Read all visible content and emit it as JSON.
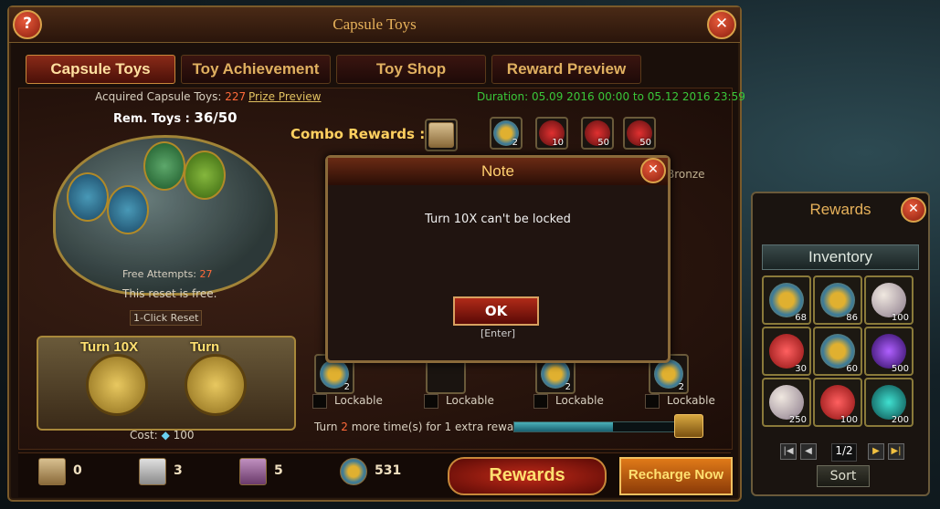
{
  "window": {
    "title": "Capsule Toys",
    "help_label": "?",
    "close_label": "✕"
  },
  "tabs": [
    {
      "label": "Capsule Toys",
      "active": true
    },
    {
      "label": "Toy Achievement",
      "active": false
    },
    {
      "label": "Toy Shop",
      "active": false
    },
    {
      "label": "Reward Preview",
      "active": false
    }
  ],
  "info": {
    "acquired_label": "Acquired Capsule Toys:",
    "acquired_value": "227",
    "prize_preview": "Prize Preview",
    "duration": "Duration: 05.09 2016 00:00 to 05.12 2016 23:59",
    "rem_toys_label": "Rem. Toys :",
    "rem_toys_value": "36/50",
    "combo_rewards_label": "Combo Rewards :",
    "combo_counts": [
      "2",
      "10",
      "50",
      "50"
    ],
    "bronze_label": "Bronze"
  },
  "machine": {
    "free_attempts_label": "Free Attempts:",
    "free_attempts_value": "27",
    "reset_note": "This reset is free.",
    "reset_button": "1-Click Reset",
    "turn10_label": "Turn 10X",
    "turn_label": "Turn",
    "cost_label": "Cost:",
    "cost_value": "100"
  },
  "lockable": {
    "slots": [
      {
        "count": "2",
        "label": "Lockable"
      },
      {
        "count": "",
        "label": "Lockable"
      },
      {
        "count": "2",
        "label": "Lockable"
      },
      {
        "count": "2",
        "label": "Lockable"
      }
    ],
    "turn_prefix": "Turn",
    "turn_value": "2",
    "turn_suffix": "more time(s) for 1 extra reward.",
    "progress": 0.6
  },
  "bottom": {
    "resources": [
      "0",
      "3",
      "5",
      "531"
    ],
    "rewards_button": "Rewards",
    "recharge_button": "Recharge Now"
  },
  "modal": {
    "title": "Note",
    "message": "Turn 10X can't be locked",
    "ok_button": "OK",
    "enter_hint": "[Enter]"
  },
  "rewards_panel": {
    "title": "Rewards",
    "inventory_tab": "Inventory",
    "items": [
      {
        "icon": "gold-coin-icon",
        "count": "68"
      },
      {
        "icon": "gold-coin-icon",
        "count": "86"
      },
      {
        "icon": "pearl-orb-icon",
        "count": "100"
      },
      {
        "icon": "red-crystal-icon",
        "count": "30"
      },
      {
        "icon": "gold-coin-icon",
        "count": "60"
      },
      {
        "icon": "purple-orb-icon",
        "count": "500"
      },
      {
        "icon": "pearl-orb-icon",
        "count": "250"
      },
      {
        "icon": "red-crystal-icon",
        "count": "100"
      },
      {
        "icon": "teal-orb-icon",
        "count": "200"
      }
    ],
    "page": "1/2",
    "sort_button": "Sort"
  },
  "colors": {
    "accent": "#e6b15a",
    "highlight": "#ff6a3a",
    "duration_green": "#3ac83a"
  }
}
